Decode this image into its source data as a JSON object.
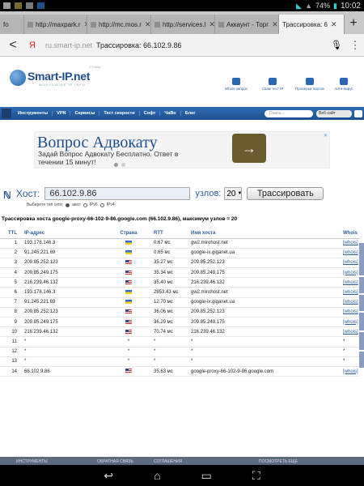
{
  "status": {
    "battery": "74%",
    "time": "10:02"
  },
  "tabs": [
    {
      "label": "fo",
      "active": false
    },
    {
      "label": "http://maxpark.r",
      "active": false
    },
    {
      "label": "http://mc.mos.r",
      "active": false
    },
    {
      "label": "http://services.l",
      "active": false
    },
    {
      "label": "Аккаунт - Торг",
      "active": false
    },
    {
      "label": "Трассировка: 6",
      "active": true
    }
  ],
  "address": {
    "yandex_glyph": "Я",
    "host": "ru.smart-ip.net",
    "title": "Трассировка: 66.102.9.86"
  },
  "site": {
    "logo": "Smart-IP.net",
    "logo_sub": "WORLDWIDE IP INFO",
    "version": "2.0 beta",
    "header_links": [
      "Whois-запрос",
      "Спам тест IP",
      "Проверка портов",
      "Анти-вирус"
    ],
    "nav": [
      "Инструменты",
      "VPN",
      "Сервисы",
      "Тест скорости",
      "Софт",
      "ЧаВо",
      "Блог"
    ],
    "search_placeholder": "Поиск...",
    "search_scope": "Веб-сайт"
  },
  "ad": {
    "title": "Вопрос Адвокату",
    "text": "Задай Вопрос Адвокату Бесплатно. Ответ в течении 15 минут!",
    "arrow": "→",
    "close": "✕"
  },
  "form": {
    "host_label": "Хост:",
    "host_value": "66.102.9.86",
    "hops_label": "узлов:",
    "hops_value": "20",
    "button": "Трассировать",
    "net_label": "Выберите тип сети:",
    "net_options": [
      "авто",
      "IPv6",
      "IPv4"
    ]
  },
  "summary": "Трассировка хоста google-proxy-66-102-9-86.google.com (66.102.9.86), максимум узлов = 20",
  "table": {
    "headers": [
      "TTL",
      "IP-адрес",
      "Страна",
      "RTT",
      "Имя хоста",
      "Whois"
    ],
    "rows": [
      {
        "ttl": "1",
        "ip": "193.178.146.3",
        "flag": "ua",
        "rtt": "0.67 мс",
        "host": "gw2.mirohost.net",
        "whois": "[whois]"
      },
      {
        "ttl": "2",
        "ip": "91.245.221.69",
        "flag": "ua",
        "rtt": "0.65 мс",
        "host": "google-ix.giganet.ua",
        "whois": "[whois]"
      },
      {
        "ttl": "3",
        "ip": "209.85.252.123",
        "flag": "us",
        "rtt": "35.27 мс",
        "host": "209.85.252.123",
        "whois": "[whois]"
      },
      {
        "ttl": "4",
        "ip": "209.85.249.175",
        "flag": "us",
        "rtt": "35.34 мс",
        "host": "209.85.249.175",
        "whois": "[whois]"
      },
      {
        "ttl": "5",
        "ip": "216.239.46.132",
        "flag": "us",
        "rtt": "35.40 мс",
        "host": "216.239.46.132",
        "whois": "[whois]"
      },
      {
        "ttl": "6",
        "ip": "193.178.146.3",
        "flag": "ua",
        "rtt": "2853.43 мс",
        "host": "gw2.mirohost.net",
        "whois": "[whois]"
      },
      {
        "ttl": "7",
        "ip": "91.245.221.69",
        "flag": "ua",
        "rtt": "12.70 мс",
        "host": "google-ix.giganet.ua",
        "whois": "[whois]"
      },
      {
        "ttl": "8",
        "ip": "209.85.252.123",
        "flag": "us",
        "rtt": "36.06 мс",
        "host": "209.85.252.123",
        "whois": "[whois]"
      },
      {
        "ttl": "9",
        "ip": "209.85.249.175",
        "flag": "us",
        "rtt": "36.29 мс",
        "host": "209.85.249.175",
        "whois": "[whois]"
      },
      {
        "ttl": "10",
        "ip": "216.239.46.132",
        "flag": "us",
        "rtt": "70.74 мс",
        "host": "216.239.46.132",
        "whois": "[whois]"
      },
      {
        "ttl": "11",
        "ip": "*",
        "flag": "",
        "rtt": "*",
        "host": "*",
        "whois": "*"
      },
      {
        "ttl": "12",
        "ip": "*",
        "flag": "",
        "rtt": "*",
        "host": "*",
        "whois": "*"
      },
      {
        "ttl": "13",
        "ip": "*",
        "flag": "",
        "rtt": "*",
        "host": "*",
        "whois": "*"
      },
      {
        "ttl": "14",
        "ip": "66.102.9.86",
        "flag": "us",
        "rtt": "35.63 мс",
        "host": "google-proxy-66-102-9-86.google.com",
        "whois": "[whois]"
      }
    ]
  },
  "footer": [
    "ИНСТРУМЕНТЫ",
    "ОБРАТНАЯ СВЯЗЬ",
    "СОГЛАШЕНИЯ",
    "ПОСМОТРЕТЬ ЕЩЕ"
  ],
  "system_nav": {
    "back": "↩",
    "home": "⌂",
    "recents": "▭",
    "screenshot": "⛶"
  }
}
